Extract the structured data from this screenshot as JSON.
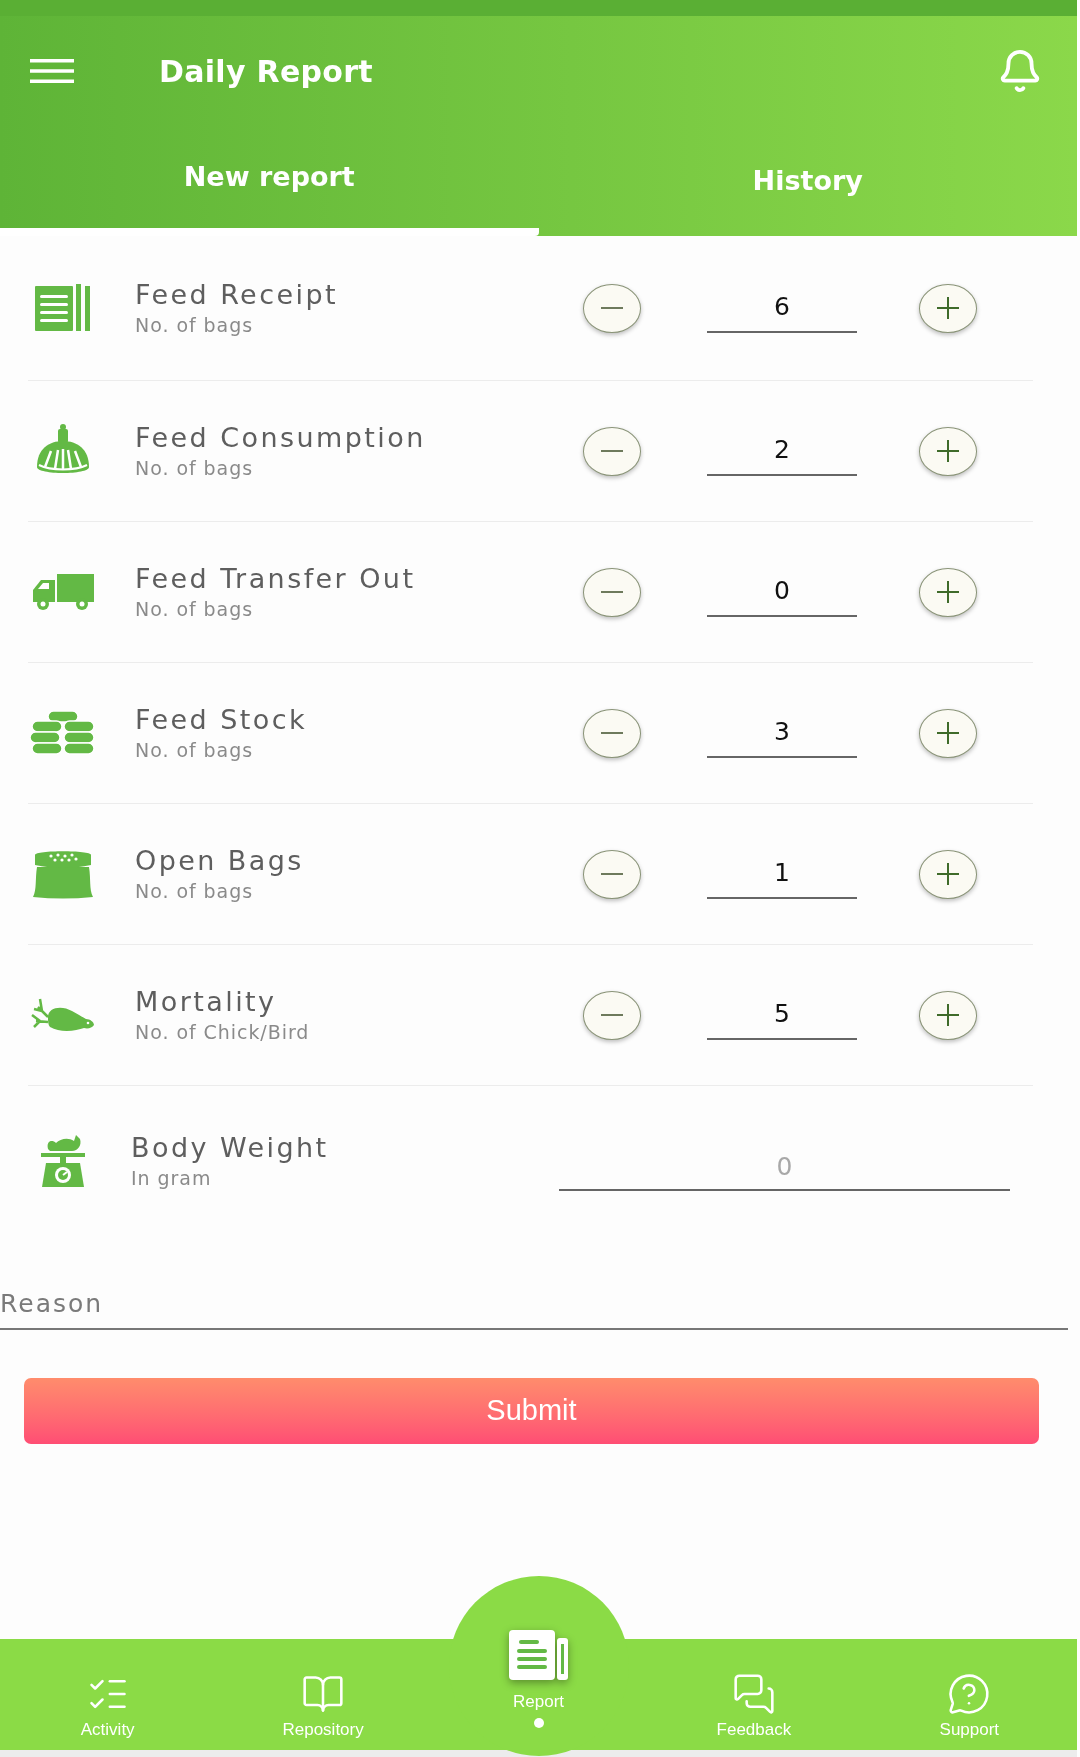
{
  "header": {
    "title": "Daily Report"
  },
  "tabs": [
    {
      "label": "New report",
      "selected": true
    },
    {
      "label": "History",
      "selected": false
    }
  ],
  "items": [
    {
      "kind": "stepper",
      "title": "Feed Receipt",
      "subtitle": "No. of bags",
      "value": "6"
    },
    {
      "kind": "stepper",
      "title": "Feed Consumption",
      "subtitle": "No. of bags",
      "value": "2"
    },
    {
      "kind": "stepper",
      "title": "Feed Transfer Out",
      "subtitle": "No. of bags",
      "value": "0"
    },
    {
      "kind": "stepper",
      "title": "Feed Stock",
      "subtitle": "No. of bags",
      "value": "3"
    },
    {
      "kind": "stepper",
      "title": "Open Bags",
      "subtitle": "No. of bags",
      "value": "1"
    },
    {
      "kind": "stepper",
      "title": "Mortality",
      "subtitle": "No. of Chick/Bird",
      "value": "5"
    },
    {
      "kind": "input",
      "title": "Body Weight",
      "subtitle": "In gram",
      "placeholder": "0"
    }
  ],
  "reason": {
    "placeholder": "Reason"
  },
  "submit": {
    "label": "Submit"
  },
  "bottom_nav": [
    {
      "label": "Activity",
      "selected": false
    },
    {
      "label": "Repository",
      "selected": false
    },
    {
      "label": "Report",
      "selected": true
    },
    {
      "label": "Feedback",
      "selected": false
    },
    {
      "label": "Support",
      "selected": false
    }
  ]
}
